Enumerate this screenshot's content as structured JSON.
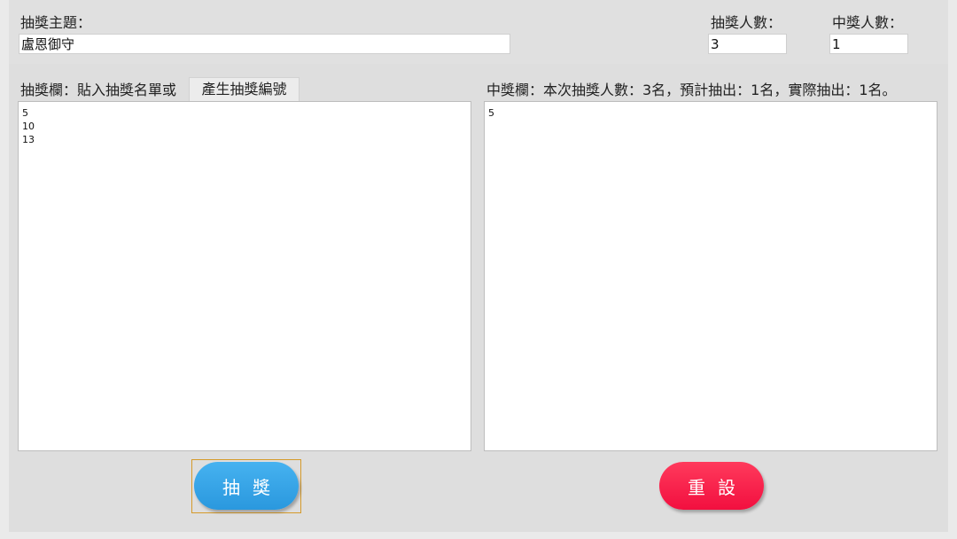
{
  "header": {
    "topic_label": "抽獎主題：",
    "topic_value": "盧恩御守",
    "participants_label": "抽獎人數：",
    "participants_value": "3",
    "winners_label": "中獎人數：",
    "winners_value": "1"
  },
  "left_panel": {
    "label": "抽獎欄：貼入抽獎名單或",
    "generate_button": "產生抽獎編號",
    "entries": [
      "5",
      "10",
      "13"
    ]
  },
  "right_panel": {
    "label": "中獎欄：本次抽獎人數：3名，預計抽出：1名，實際抽出：1名。",
    "entries": [
      "5"
    ]
  },
  "actions": {
    "draw_label": "抽獎",
    "reset_label": "重設"
  },
  "colors": {
    "draw_button": "#2a98de",
    "reset_button": "#f20f3f",
    "focus_outline": "#d59a2a"
  }
}
